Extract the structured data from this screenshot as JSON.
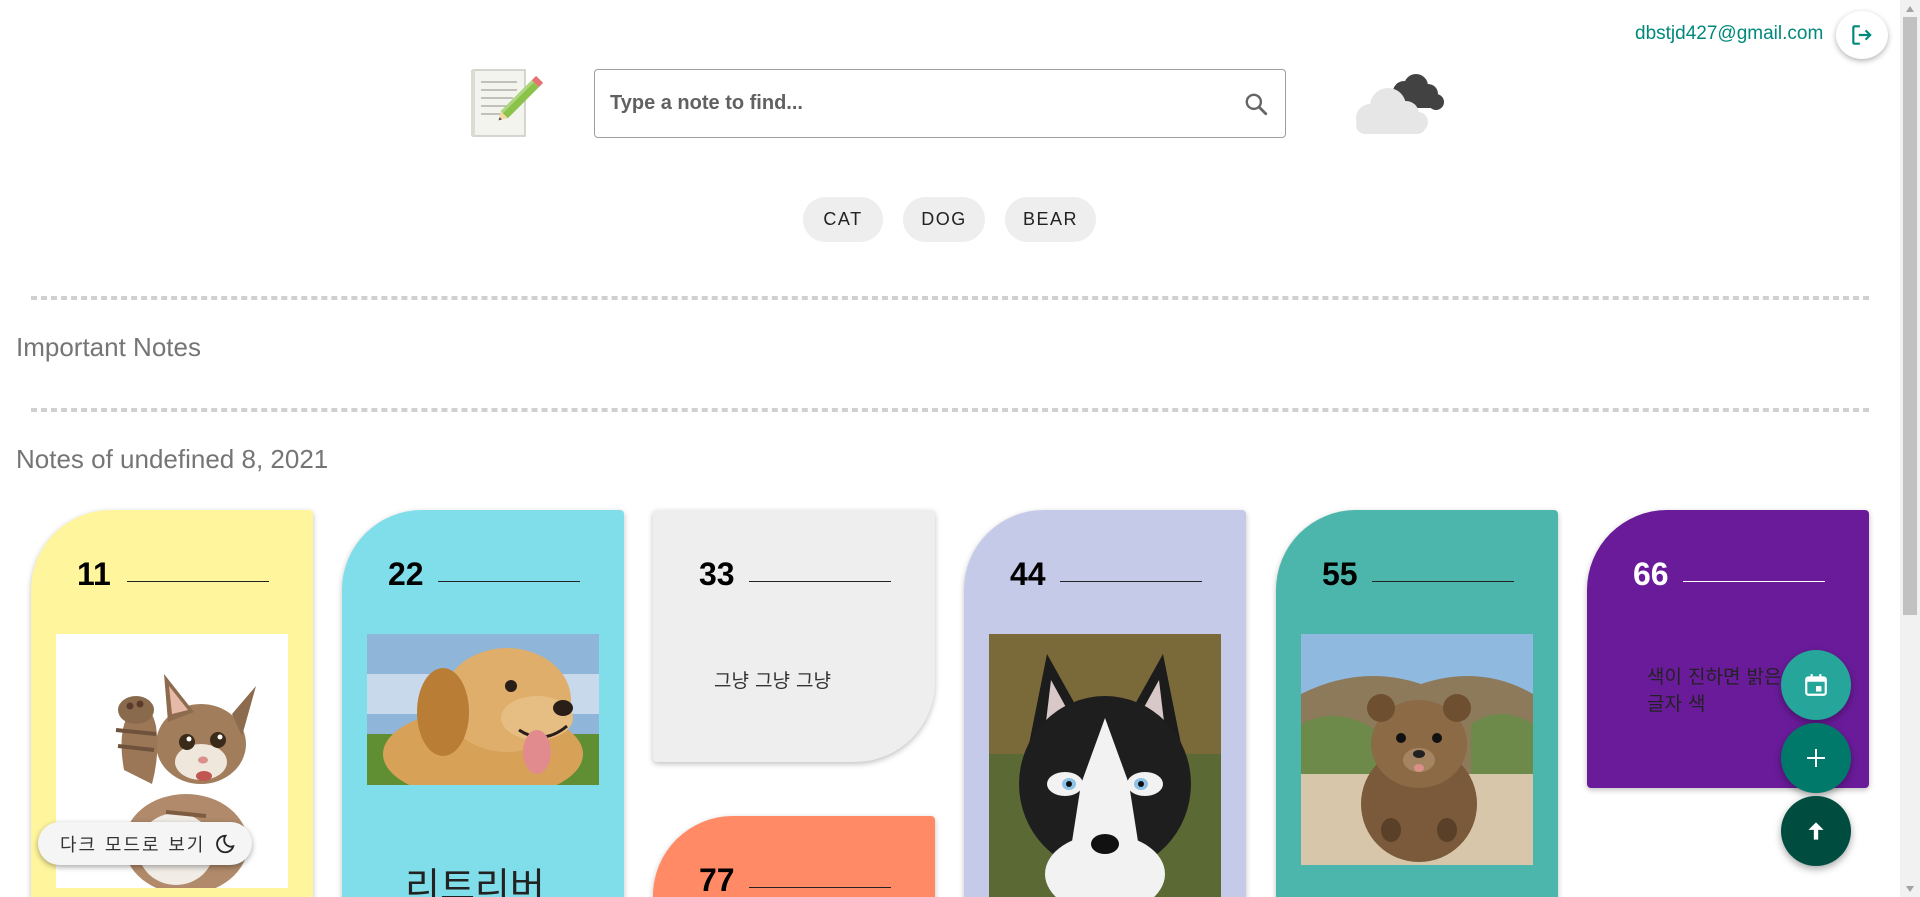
{
  "header": {
    "user_email": "dbstjd427@gmail.com",
    "search_placeholder": "Type a note to find..."
  },
  "icons": {
    "logout": "logout-icon",
    "logo": "notepad-pencil-icon",
    "search": "search-icon",
    "weather": "cloudy-weather-icon",
    "moon": "moon-icon",
    "calendar": "calendar-icon",
    "add": "plus-icon",
    "scroll_top": "arrow-up-icon"
  },
  "chips": [
    "CAT",
    "DOG",
    "BEAR"
  ],
  "sections": {
    "important_title": "Important Notes",
    "dated_title": "Notes of undefined 8, 2021"
  },
  "cards": [
    {
      "number": "11",
      "color": "#fff59d",
      "image": "cat",
      "text": ""
    },
    {
      "number": "22",
      "color": "#80deea",
      "image": "golden-retriever",
      "text": "리트리버"
    },
    {
      "number": "33",
      "color": "#eeeeee",
      "image": "",
      "text": "그냥 그냥 그냥"
    },
    {
      "number": "44",
      "color": "#c5cae9",
      "image": "husky",
      "text": ""
    },
    {
      "number": "55",
      "color": "#4db6ac",
      "image": "quokka",
      "text": ""
    },
    {
      "number": "66",
      "color": "#6a1b9a",
      "image": "",
      "text": "색이 진하면 밝은 글자 색"
    },
    {
      "number": "77",
      "color": "#ff8a65",
      "image": "",
      "text": ""
    }
  ],
  "dark_mode_label": "다크 모드로 보기",
  "colors": {
    "accent": "#00897b",
    "fab_calendar": "#26a69a",
    "fab_add": "#00796b",
    "fab_top": "#004d40"
  }
}
